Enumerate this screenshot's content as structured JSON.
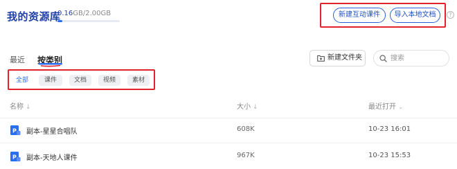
{
  "header": {
    "title": "我的资源库",
    "storage_used": "0.16",
    "storage_rest": "GB/2.00GB",
    "storage_fraction": 0.08,
    "btn_interactive": "新建互动课件",
    "btn_import": "导入本地文档",
    "help_glyph": "?"
  },
  "tabs": {
    "recent": "最近",
    "category": "按类别"
  },
  "toolbar": {
    "new_folder": "新建文件夹",
    "search_placeholder": "搜索"
  },
  "filters": [
    "全部",
    "课件",
    "文档",
    "视频",
    "素材"
  ],
  "columns": {
    "name": "名称",
    "size": "大小",
    "time": "最近打开",
    "sort_arrow": "↓",
    "time_arrow": "⌄"
  },
  "files": [
    {
      "name": "副本-星星合唱队",
      "size": "608K",
      "time": "10-23 16:01"
    },
    {
      "name": "副本-天地人课件",
      "size": "967K",
      "time": "10-23 15:53"
    }
  ],
  "colors": {
    "brand_blue": "#2a6ef0",
    "title_blue": "#1f3fa8",
    "annotation_red": "#e0232b"
  }
}
